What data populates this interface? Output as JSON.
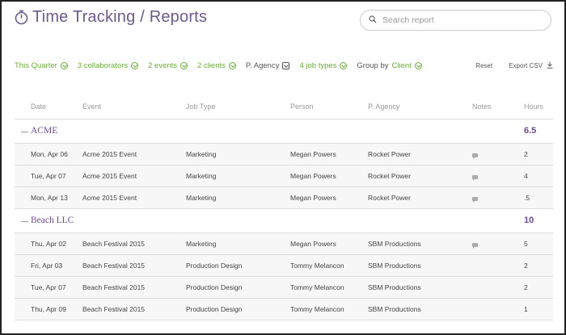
{
  "header": {
    "title": "Time Tracking / Reports",
    "search_placeholder": "Search report"
  },
  "filters": {
    "quarter": "This Quarter",
    "collaborators": "3 collaborators",
    "events": "2 events",
    "clients": "2 clients",
    "agency": "P. Agency",
    "job_types": "4 job types",
    "group_by_label": "Group by",
    "group_by_value": "Client",
    "reset": "Reset",
    "export": "Export CSV"
  },
  "columns": {
    "date": "Date",
    "event": "Event",
    "job": "Job Type",
    "person": "Person",
    "agency": "P. Agency",
    "notes": "Notes",
    "hours": "Hours"
  },
  "groups": [
    {
      "name": "ACME",
      "total": "6.5",
      "rows": [
        {
          "date": "Mon, Apr 06",
          "event": "Acme 2015 Event",
          "job": "Marketing",
          "person": "Megan Powers",
          "agency": "Rocket Power",
          "has_note": true,
          "hours": "2"
        },
        {
          "date": "Tue, Apr 07",
          "event": "Acme 2015 Event",
          "job": "Marketing",
          "person": "Megan Powers",
          "agency": "Rocket Power",
          "has_note": true,
          "hours": "4"
        },
        {
          "date": "Mon, Apr 13",
          "event": "Acme 2015 Event",
          "job": "Marketing",
          "person": "Megan Powers",
          "agency": "Rocket Power",
          "has_note": true,
          "hours": ".5"
        }
      ]
    },
    {
      "name": "Beach LLC",
      "total": "10",
      "rows": [
        {
          "date": "Thu, Apr 02",
          "event": "Beach Festival 2015",
          "job": "Marketing",
          "person": "Megan Powers",
          "agency": "SBM Productions",
          "has_note": true,
          "hours": "5"
        },
        {
          "date": "Fri, Apr 03",
          "event": "Beach Festival 2015",
          "job": "Production Design",
          "person": "Tommy Melancon",
          "agency": "SBM Productions",
          "has_note": false,
          "hours": "2"
        },
        {
          "date": "Tue, Apr 07",
          "event": "Beach Festival 2015",
          "job": "Production Design",
          "person": "Tommy Melancon",
          "agency": "SBM Productions",
          "has_note": false,
          "hours": "2"
        },
        {
          "date": "Thu, Apr 09",
          "event": "Beach Festival 2015",
          "job": "Production Design",
          "person": "Tommy Melancon",
          "agency": "SBM Productions",
          "has_note": false,
          "hours": "1"
        }
      ]
    }
  ],
  "colors": {
    "accent_purple": "#6b4a8c",
    "filter_green": "#6aaa3a"
  }
}
